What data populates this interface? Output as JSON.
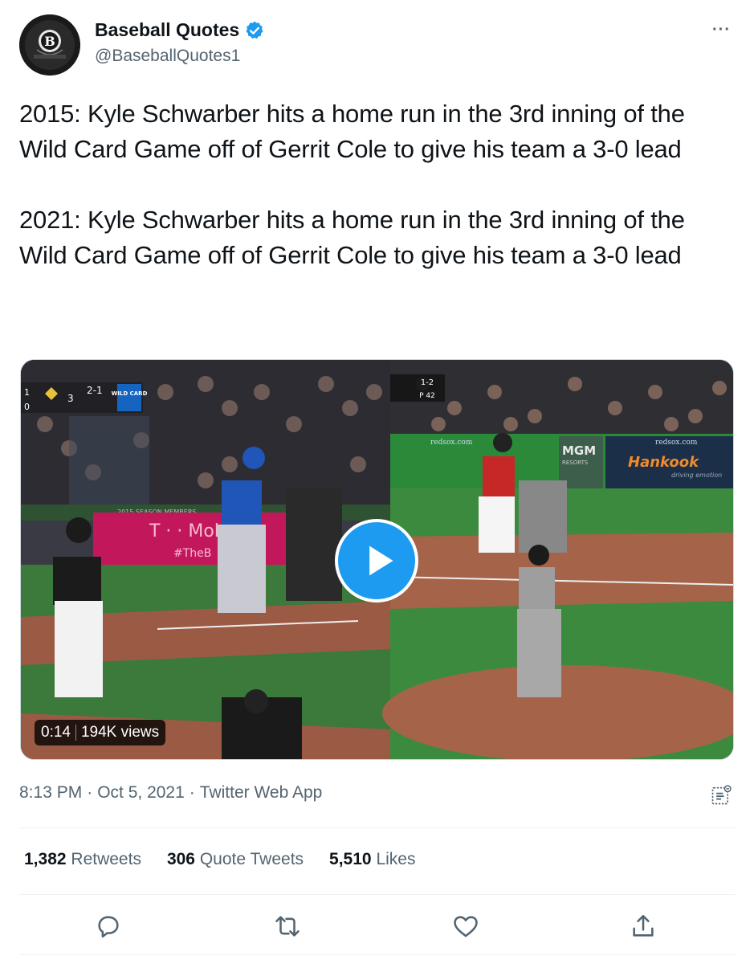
{
  "author": {
    "display_name": "Baseball Quotes",
    "handle": "@BaseballQuotes1",
    "verified_icon": "verified-badge-icon",
    "avatar_icon": "baseball-logo-icon"
  },
  "tweet": {
    "text": "2015: Kyle Schwarber hits a home run in the 3rd inning of the Wild Card Game off of Gerrit Cole to give his team a 3-0 lead\n\n2021: Kyle Schwarber hits a home run in the 3rd inning of the Wild Card Game off of Gerrit Cole to give his team a 3-0 lead"
  },
  "media": {
    "duration": "0:14",
    "views": "194K views",
    "play_icon": "play-icon",
    "left_scoreboard": {
      "inning": "3",
      "count": "2-1",
      "outs_top": "1",
      "outs_bottom": "0",
      "tag": "WILD CARD"
    },
    "right_scoreboard": {
      "count": "1-2",
      "pitch_count": "P 42"
    },
    "signage": {
      "tmobile": "T · · Mob",
      "hashtag": "#TheB",
      "mgm": "MGM",
      "mgm_sub": "RESORTS",
      "hankook": "Hankook",
      "hankook_sub": "driving emotion",
      "redsox": "redsox.com",
      "season": "2015 SEASON MEMBERS"
    }
  },
  "meta": {
    "time": "8:13 PM",
    "separator": "·",
    "date": "Oct 5, 2021",
    "app": "Twitter Web App"
  },
  "stats": {
    "retweets_count": "1,382",
    "retweets_label": "Retweets",
    "quotes_count": "306",
    "quotes_label": "Quote Tweets",
    "likes_count": "5,510",
    "likes_label": "Likes"
  },
  "actions": [
    "reply-icon",
    "retweet-icon",
    "like-icon",
    "share-icon"
  ],
  "colors": {
    "accent": "#1d9bf0",
    "text": "#0f1419",
    "secondary": "#536471",
    "divider": "#eff3f4"
  },
  "more_label": "···"
}
